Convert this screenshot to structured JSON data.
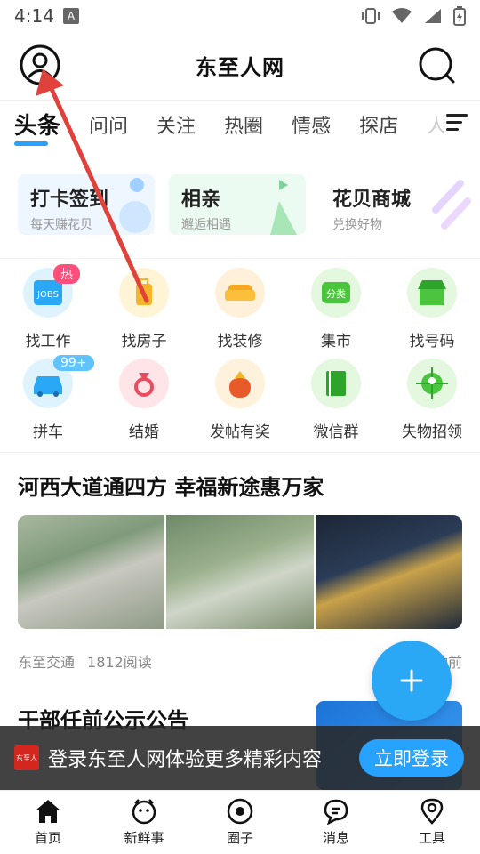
{
  "status": {
    "time": "4:14",
    "a_badge": "A"
  },
  "header": {
    "title": "东至人网"
  },
  "tabs": [
    {
      "label": "头条"
    },
    {
      "label": "问问"
    },
    {
      "label": "关注"
    },
    {
      "label": "热圈"
    },
    {
      "label": "情感"
    },
    {
      "label": "探店"
    },
    {
      "label": "人"
    }
  ],
  "cards": [
    {
      "title": "打卡签到",
      "subtitle": "每天赚花贝"
    },
    {
      "title": "相亲",
      "subtitle": "邂逅相遇"
    },
    {
      "title": "花贝商城",
      "subtitle": "兑换好物"
    }
  ],
  "grid": [
    {
      "label": "找工作",
      "icon": "jobs-icon",
      "badge": "热"
    },
    {
      "label": "找房子",
      "icon": "luggage-icon"
    },
    {
      "label": "找装修",
      "icon": "sofa-icon"
    },
    {
      "label": "集市",
      "icon": "category-icon"
    },
    {
      "label": "找号码",
      "icon": "shop-icon"
    },
    {
      "label": "拼车",
      "icon": "car-icon",
      "badge": "99+"
    },
    {
      "label": "结婚",
      "icon": "ring-icon"
    },
    {
      "label": "发帖有奖",
      "icon": "money-bag-icon"
    },
    {
      "label": "微信群",
      "icon": "book-icon"
    },
    {
      "label": "失物招领",
      "icon": "locate-person-icon"
    }
  ],
  "icon_labels": {
    "jobs": "JOBS",
    "category": "分类"
  },
  "article": {
    "title": "河西大道通四方 幸福新途惠万家",
    "source": "东至交通",
    "reads": "1812阅读",
    "time": "钟前"
  },
  "article2": {
    "title": "干部任前公示公告"
  },
  "login_banner": {
    "logo_text": "东至人",
    "message": "登录东至人网体验更多精彩内容",
    "button": "立即登录"
  },
  "bottom_nav": [
    {
      "label": "首页",
      "icon": "home-icon"
    },
    {
      "label": "新鲜事",
      "icon": "face-icon"
    },
    {
      "label": "圈子",
      "icon": "circle-icon"
    },
    {
      "label": "消息",
      "icon": "message-icon"
    },
    {
      "label": "工具",
      "icon": "location-pin-icon"
    }
  ],
  "colors": {
    "accent": "#27a3ff",
    "hot_badge": "#ff4f7a",
    "annotation_arrow": "#e0413a"
  }
}
